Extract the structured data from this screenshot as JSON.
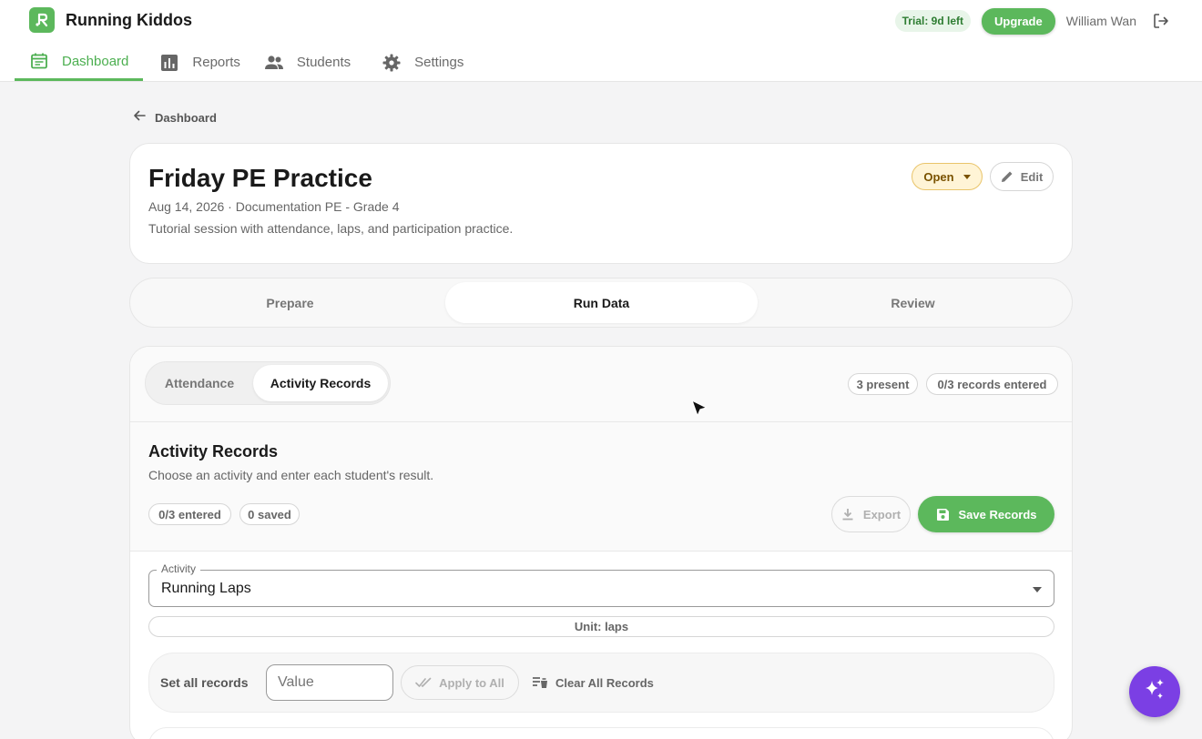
{
  "app": {
    "name": "Running Kiddos",
    "trial_badge": "Trial: 9d left",
    "upgrade_label": "Upgrade",
    "user_name": "William Wan",
    "brand_color": "#5cb85c",
    "accent_color": "#7b3fe4"
  },
  "nav": {
    "items": [
      {
        "label": "Dashboard",
        "icon": "calendar-icon",
        "active": true
      },
      {
        "label": "Reports",
        "icon": "bar-chart-icon",
        "active": false
      },
      {
        "label": "Students",
        "icon": "people-icon",
        "active": false
      },
      {
        "label": "Settings",
        "icon": "gear-icon",
        "active": false
      }
    ]
  },
  "breadcrumb": {
    "label": "Dashboard"
  },
  "session": {
    "title": "Friday PE Practice",
    "meta": "Aug 14, 2026 · Documentation PE - Grade 4",
    "description": "Tutorial session with attendance, laps, and participation practice.",
    "status": "Open",
    "edit_label": "Edit"
  },
  "stage_tabs": {
    "items": [
      "Prepare",
      "Run Data",
      "Review"
    ],
    "active": "Run Data"
  },
  "panel": {
    "segments": [
      "Attendance",
      "Activity Records"
    ],
    "active_segment": "Activity Records",
    "present_pill": "3 present",
    "records_pill": "0/3 records entered"
  },
  "records": {
    "title": "Activity Records",
    "subtitle": "Choose an activity and enter each student's result.",
    "entered_pill": "0/3 entered",
    "saved_pill": "0 saved",
    "export_label": "Export",
    "save_label": "Save Records"
  },
  "activity": {
    "legend": "Activity",
    "value": "Running Laps",
    "unit": "Unit: laps"
  },
  "bulk": {
    "label": "Set all records",
    "placeholder": "Value",
    "apply_label": "Apply to All",
    "clear_label": "Clear All Records"
  }
}
